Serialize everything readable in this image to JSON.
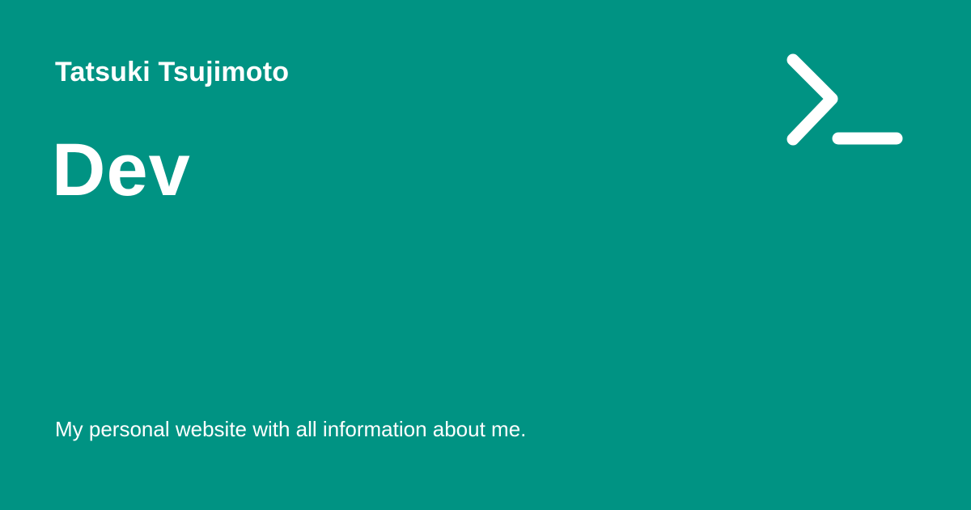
{
  "card": {
    "author": "Tatsuki Tsujimoto",
    "title": "Dev",
    "description": "My personal website with all information about me.",
    "icon": "terminal-prompt-icon",
    "background_color": "#009383",
    "text_color": "#ffffff"
  }
}
